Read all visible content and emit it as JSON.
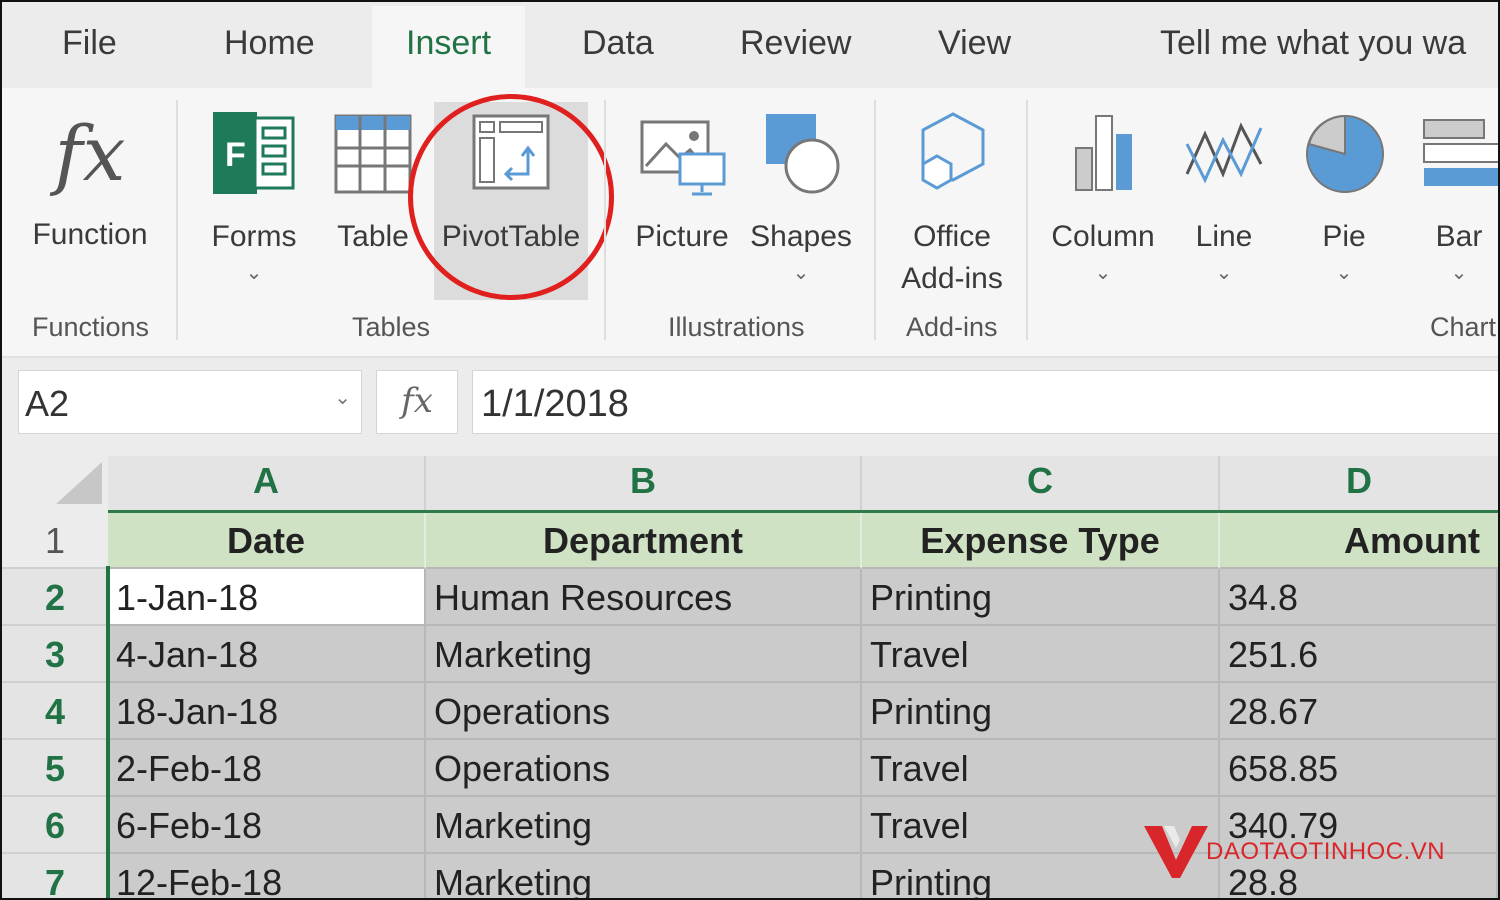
{
  "tabs": [
    "File",
    "Home",
    "Insert",
    "Data",
    "Review",
    "View",
    "Tell me what you wa"
  ],
  "ribbon": {
    "function": {
      "label": "Function"
    },
    "forms": {
      "label": "Forms"
    },
    "table": {
      "label": "Table"
    },
    "pivottable": {
      "label": "PivotTable"
    },
    "picture": {
      "label": "Picture"
    },
    "shapes": {
      "label": "Shapes"
    },
    "office_addins": {
      "label_line1": "Office",
      "label_line2": "Add-ins"
    },
    "column": {
      "label": "Column"
    },
    "line": {
      "label": "Line"
    },
    "pie": {
      "label": "Pie"
    },
    "bar": {
      "label": "Bar"
    },
    "groups": [
      "Functions",
      "Tables",
      "Illustrations",
      "Add-ins",
      "Chart"
    ],
    "fx_glyph": "fx"
  },
  "formula_bar": {
    "name_box": "A2",
    "fx": "fx",
    "value": "1/1/2018"
  },
  "columns": [
    "A",
    "B",
    "C",
    "D"
  ],
  "row_numbers": [
    "1",
    "2",
    "3",
    "4",
    "5",
    "6",
    "7"
  ],
  "header_row": [
    "Date",
    "Department",
    "Expense Type",
    "Amount"
  ],
  "rows": [
    [
      "1-Jan-18",
      "Human Resources",
      "Printing",
      "34.8"
    ],
    [
      "4-Jan-18",
      "Marketing",
      "Travel",
      "251.6"
    ],
    [
      "18-Jan-18",
      "Operations",
      "Printing",
      "28.67"
    ],
    [
      "2-Feb-18",
      "Operations",
      "Travel",
      "658.85"
    ],
    [
      "6-Feb-18",
      "Marketing",
      "Travel",
      "340.79"
    ],
    [
      "12-Feb-18",
      "Marketing",
      "Printing",
      "28.8"
    ]
  ],
  "watermark": "DAOTAOTINHOC.VN",
  "colors": {
    "excel_green": "#217346",
    "highlight_circle": "#e0201f",
    "header_fill": "#cfe3c4"
  }
}
